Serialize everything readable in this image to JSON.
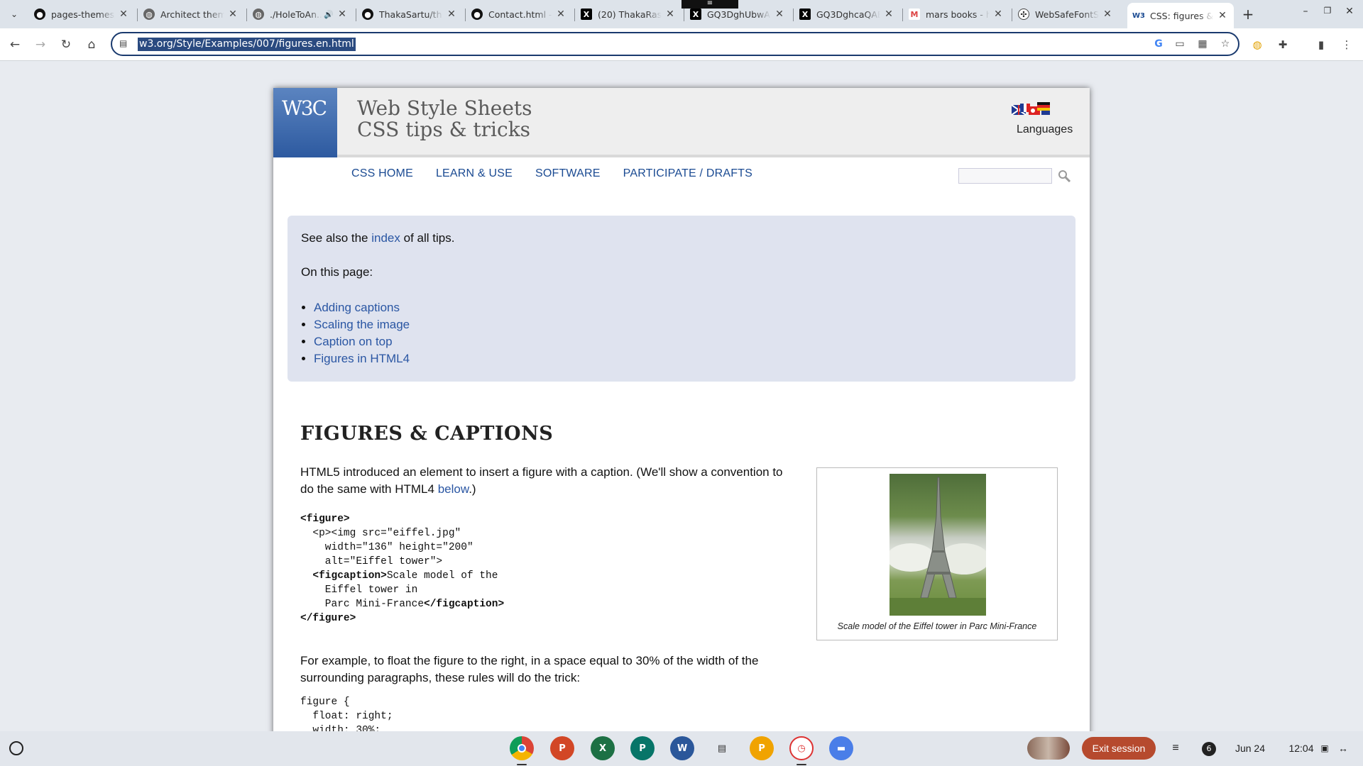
{
  "browser": {
    "tabs": [
      {
        "title": "pages-themes/...",
        "favicon": "github-icon",
        "active": false
      },
      {
        "title": "Architect theme",
        "favicon": "globe-icon",
        "active": false
      },
      {
        "title": "./HoleToAn...",
        "favicon": "globe-icon",
        "active": false,
        "audio": true
      },
      {
        "title": "ThakaSartu/th...",
        "favicon": "github-icon",
        "active": false
      },
      {
        "title": "Contact.html - ...",
        "favicon": "github-icon",
        "active": false
      },
      {
        "title": "(20) ThakaRas...",
        "favicon": "x-icon",
        "active": false
      },
      {
        "title": "GQ3DghUbwAg...",
        "favicon": "x-icon",
        "active": false
      },
      {
        "title": "GQ3DghcaQAE...",
        "favicon": "x-icon",
        "active": false
      },
      {
        "title": "mars books - h...",
        "favicon": "gmail-icon",
        "active": false
      },
      {
        "title": "WebSafeFontS...",
        "favicon": "chatgpt-icon",
        "active": false
      },
      {
        "title": "CSS: figures & c...",
        "favicon": "w3c-icon",
        "active": true
      }
    ],
    "url": "w3.org/Style/Examples/007/figures.en.html"
  },
  "page": {
    "site_title_line1": "Web Style Sheets",
    "site_title_line2": "CSS tips & tricks",
    "logo_text": "W3C",
    "languages_label": "Languages",
    "menu": [
      "CSS HOME",
      "LEARN & USE",
      "SOFTWARE",
      "PARTICIPATE / DRAFTS"
    ],
    "toc": {
      "see_also_prefix": "See also the ",
      "see_also_link": "index",
      "see_also_suffix": " of all tips.",
      "on_this_page": "On this page:",
      "items": [
        "Adding captions",
        "Scaling the image",
        "Caption on top",
        "Figures in HTML4"
      ]
    },
    "section_heading": "FIGURES & CAPTIONS",
    "intro_text": "HTML5 introduced an element to insert a figure with a caption. (We'll show a convention to do the same with HTML4 ",
    "intro_link": "below",
    "intro_end": ".)",
    "code_example_1": {
      "l1": "<figure>",
      "l2a": "  <p><img src=\"eiffel.jpg\"",
      "l3": "    width=\"136\" height=\"200\"",
      "l4": "    alt=\"Eiffel tower\">",
      "l5a": "  <figcaption>",
      "l5b": "Scale model of the",
      "l6": "    Eiffel tower in",
      "l7a": "    Parc Mini-France",
      "l7b": "</figcaption>",
      "l8": "</figure>"
    },
    "para2": "For example, to float the figure to the right, in a space equal to 30% of the width of the surrounding paragraphs, these rules will do the trick:",
    "code_example_2": {
      "l1": "figure {",
      "l2": "  float: right;",
      "l3": "  width: 30%;"
    },
    "figure_caption": "Scale model of the Eiffel tower in Parc Mini-France"
  },
  "shelf": {
    "exit_session": "Exit session",
    "notification_count": "6",
    "date": "Jun 24",
    "time": "12:04",
    "apps": [
      "chrome-icon",
      "powerpoint-icon",
      "excel-icon",
      "publisher-icon",
      "word-icon",
      "docs-icon",
      "slides-icon",
      "timer-icon",
      "files-icon"
    ]
  },
  "colors": {
    "link": "#2a56a3",
    "toc_bg": "#dfe3ef",
    "exit_button": "#b64a2e"
  }
}
